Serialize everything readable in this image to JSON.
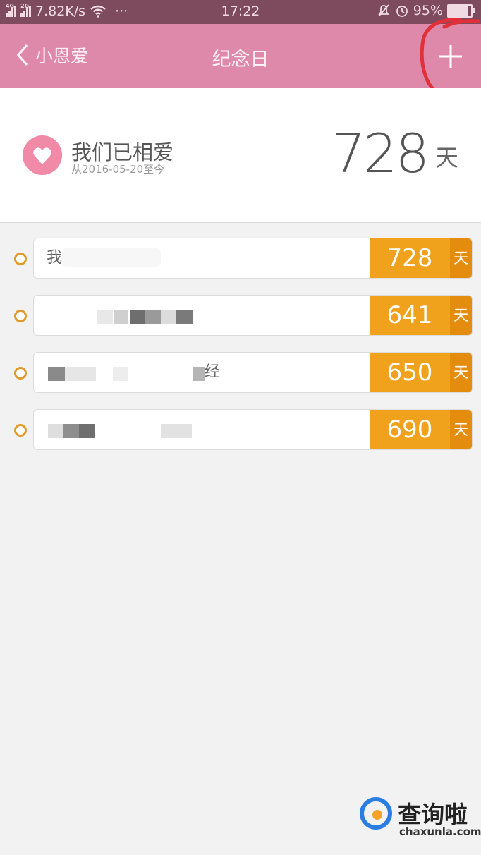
{
  "status_bar": {
    "network_left": "4G",
    "network_right": "2G",
    "speed": "7.82K/s",
    "more": "···",
    "time": "17:22",
    "battery": "95%",
    "battery_level": 0.95
  },
  "nav": {
    "back_label": "小恩爱",
    "title": "纪念日",
    "add_symbol": "+"
  },
  "summary": {
    "title": "我们已相爱",
    "since": "从2016-05-20至今",
    "count": "728",
    "unit": "天"
  },
  "anniversaries": [
    {
      "name_visible": "我",
      "days": "728",
      "unit": "天"
    },
    {
      "name_visible": "",
      "days": "641",
      "unit": "天"
    },
    {
      "name_visible": "经",
      "days": "650",
      "unit": "天"
    },
    {
      "name_visible": "",
      "days": "690",
      "unit": "天"
    }
  ],
  "watermark": {
    "brand": "查询啦",
    "domain": "chaxunla.com"
  },
  "colors": {
    "status_bar": "#7e4a5e",
    "nav_bar": "#de89aa",
    "days_bg": "#f0a21c",
    "unit_bg": "#e48c0e",
    "annotation_circle": "#e0303a"
  }
}
